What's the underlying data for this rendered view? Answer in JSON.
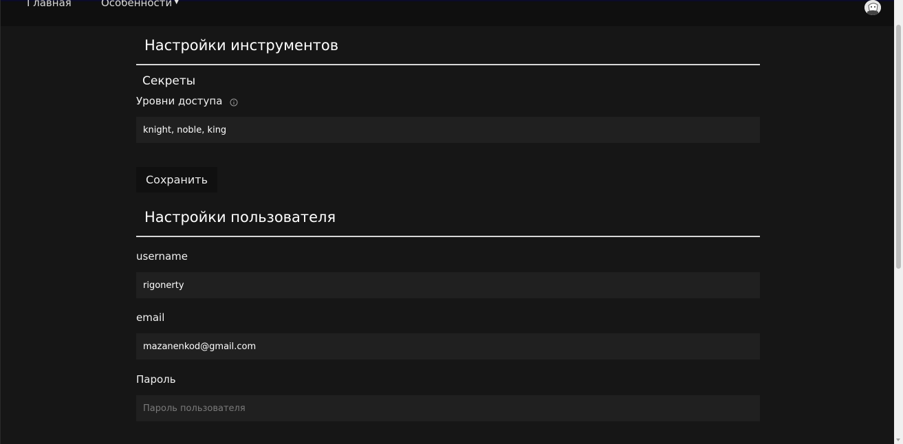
{
  "nav": {
    "home": "Главная",
    "features": "Особенности"
  },
  "tool_settings": {
    "title": "Настройки инструментов",
    "secrets_title": "Секреты",
    "access_levels_label": "Уровни доступа",
    "access_levels_value": "knight, noble, king",
    "save_label": "Сохранить"
  },
  "user_settings": {
    "title": "Настройки пользователя",
    "username_label": "username",
    "username_value": "rigonerty",
    "email_label": "email",
    "email_value": "mazanenkod@gmail.com",
    "password_label": "Пароль",
    "password_placeholder": "Пароль пользователя"
  },
  "icons": {
    "features_dropdown": "caret-down-icon",
    "access_info": "info-icon",
    "user": "avatar"
  },
  "colors": {
    "background": "#161616",
    "topbar": "#0f0f0f",
    "input_bg": "#202020",
    "divider": "#d8d8d8"
  }
}
